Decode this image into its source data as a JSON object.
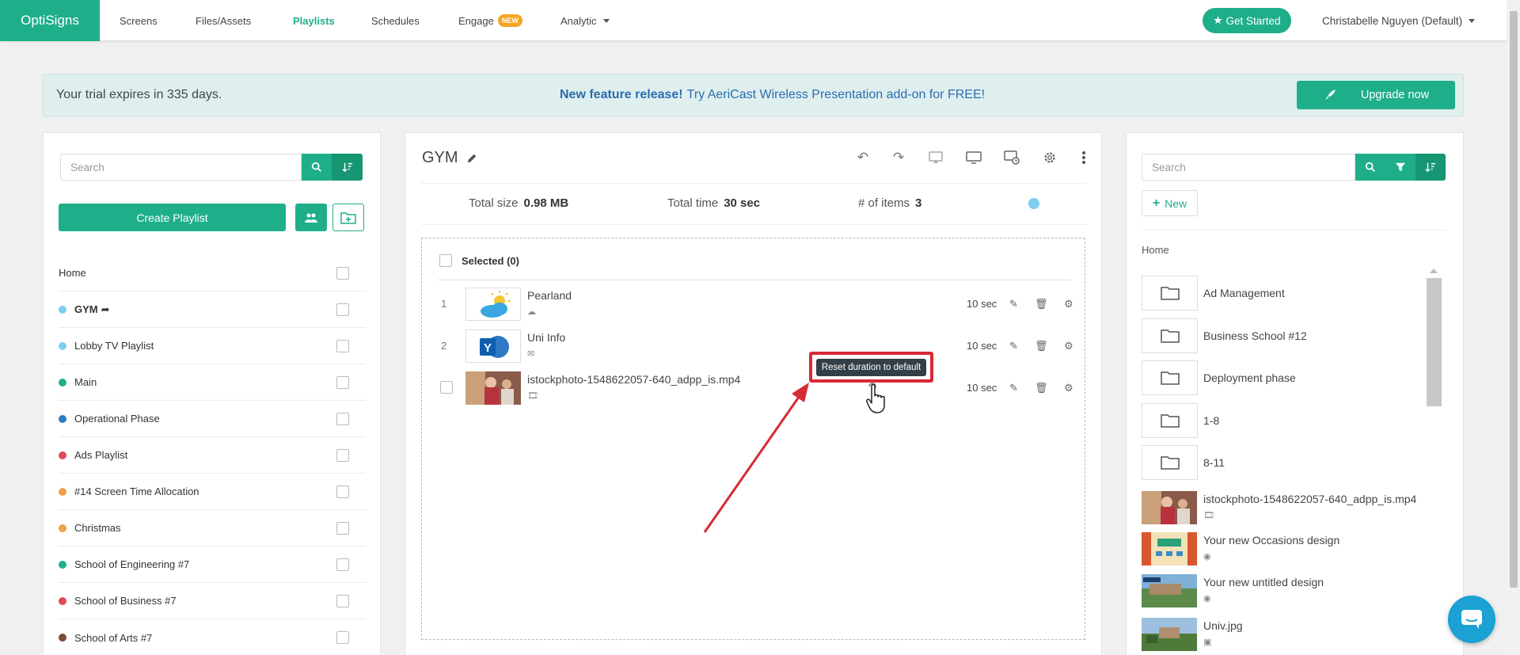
{
  "nav": {
    "logo": "OptiSigns",
    "items": [
      "Screens",
      "Files/Assets",
      "Playlists",
      "Schedules",
      "Engage",
      "Analytic"
    ],
    "engage_badge": "NEW",
    "get_started": "Get Started",
    "user": "Christabelle Nguyen (Default)"
  },
  "banner": {
    "trial": "Your trial expires in 335 days.",
    "feature_bold": "New feature release!",
    "feature_text": "Try AeriCast Wireless Presentation add-on for FREE!",
    "upgrade": "Upgrade now"
  },
  "left": {
    "search_placeholder": "Search",
    "create": "Create Playlist",
    "home": "Home",
    "playlists": [
      {
        "name": "GYM",
        "color": "#7dcdf0"
      },
      {
        "name": "Lobby TV Playlist",
        "color": "#7dcdf0"
      },
      {
        "name": "Main",
        "color": "#1fae8a"
      },
      {
        "name": "Operational Phase",
        "color": "#2a7dc0"
      },
      {
        "name": "Ads Playlist",
        "color": "#e04b58"
      },
      {
        "name": "#14 Screen Time Allocation",
        "color": "#f0a04a"
      },
      {
        "name": "Christmas",
        "color": "#f0a04a"
      },
      {
        "name": "School of Engineering #7",
        "color": "#1fae8a"
      },
      {
        "name": "School of Business #7",
        "color": "#e04b58"
      },
      {
        "name": "School of Arts #7",
        "color": "#7a4a38"
      }
    ]
  },
  "center": {
    "title": "GYM",
    "total_size_label": "Total size",
    "total_size": "0.98 MB",
    "total_time_label": "Total time",
    "total_time": "30 sec",
    "items_label": "# of items",
    "items_count": "3",
    "selected": "Selected (0)",
    "items": [
      {
        "num": "1",
        "name": "Pearland",
        "duration": "10 sec"
      },
      {
        "num": "2",
        "name": "Uni Info",
        "duration": "10 sec"
      },
      {
        "num": "",
        "name": "istockphoto-1548622057-640_adpp_is.mp4",
        "duration": "10 sec"
      }
    ],
    "tooltip": "Reset duration to default"
  },
  "right": {
    "search_placeholder": "Search",
    "new": "New",
    "home": "Home",
    "folders": [
      "Ad Management",
      "Business School #12",
      "Deployment phase",
      "1-8",
      "8-11"
    ],
    "media": [
      {
        "name": "istockphoto-1548622057-640_adpp_is.mp4"
      },
      {
        "name": "Your new Occasions design"
      },
      {
        "name": "Your new untitled design"
      },
      {
        "name": "Univ.jpg"
      }
    ]
  }
}
